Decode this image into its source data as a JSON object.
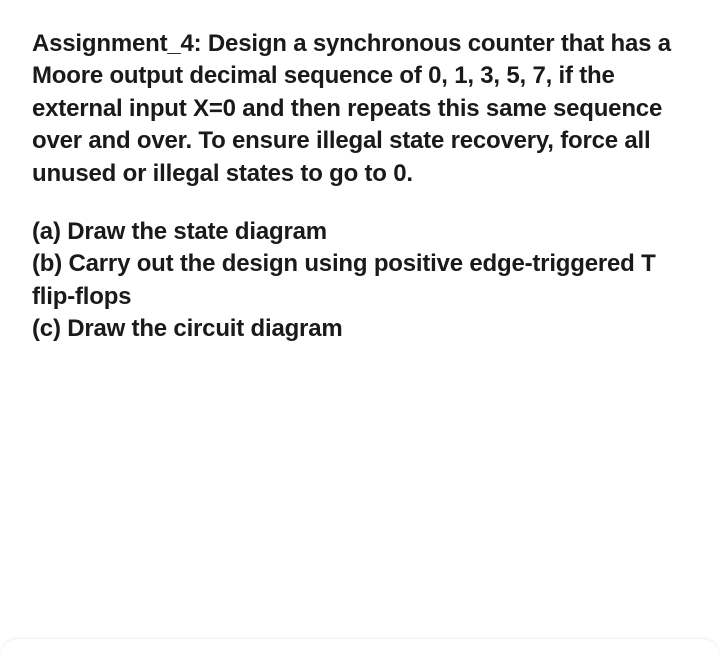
{
  "assignment": {
    "title_label": "Assignment_4:",
    "prompt": "Design a synchronous counter that has a Moore output decimal sequence of 0, 1, 3, 5, 7, if the external input X=0 and then repeats this same sequence over and over. To ensure illegal state recovery, force all unused or illegal states to go to 0."
  },
  "subparts": [
    {
      "label": "(a)",
      "text": "Draw the state diagram"
    },
    {
      "label": "(b)",
      "text": "Carry out the design using positive edge-triggered T flip-flops"
    },
    {
      "label": "(c)",
      "text": "Draw the circuit diagram"
    }
  ]
}
